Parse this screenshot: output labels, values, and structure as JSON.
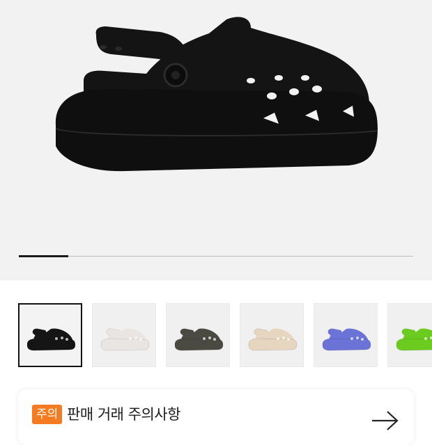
{
  "gallery": {
    "slide_progress": 0.125,
    "product_color": "#141414"
  },
  "thumbnails": [
    {
      "icon": "clog-black-icon",
      "color": "#151515",
      "selected": true
    },
    {
      "icon": "clog-white-floral-icon",
      "color": "#e9e5e2",
      "selected": false
    },
    {
      "icon": "clog-dark-olive-icon",
      "color": "#4a4a42",
      "selected": false
    },
    {
      "icon": "clog-bone-icon",
      "color": "#e6d6bf",
      "selected": false
    },
    {
      "icon": "clog-periwinkle-icon",
      "color": "#6b73d6",
      "selected": false
    },
    {
      "icon": "clog-lime-icon",
      "color": "#6ccb1f",
      "selected": false
    }
  ],
  "notice": {
    "badge": "주의",
    "title": "판매 거래 주의사항",
    "badge_color": "#f47b20",
    "arrow_icon": "arrow-right-icon"
  }
}
